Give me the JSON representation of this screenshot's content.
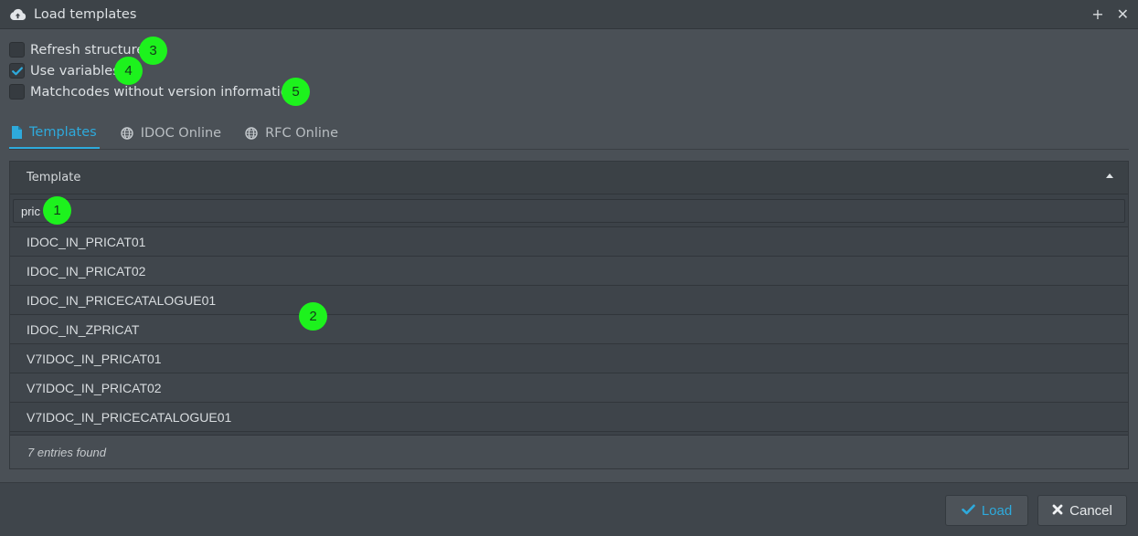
{
  "window": {
    "title": "Load templates",
    "icon": "cloud-upload-icon",
    "plus_symbol": "+",
    "close_symbol": "✕"
  },
  "options": [
    {
      "label": "Refresh structure",
      "checked": false
    },
    {
      "label": "Use variables",
      "checked": true
    },
    {
      "label": "Matchcodes without version information",
      "checked": false
    }
  ],
  "tabs": [
    {
      "label": "Templates",
      "icon": "document-icon",
      "active": true
    },
    {
      "label": "IDOC Online",
      "icon": "globe-icon",
      "active": false
    },
    {
      "label": "RFC Online",
      "icon": "globe-icon",
      "active": false
    }
  ],
  "grid": {
    "column_header": "Template",
    "filter_value": "pric",
    "rows": [
      "IDOC_IN_PRICAT01",
      "IDOC_IN_PRICAT02",
      "IDOC_IN_PRICECATALOGUE01",
      "IDOC_IN_ZPRICAT",
      "V7IDOC_IN_PRICAT01",
      "V7IDOC_IN_PRICAT02",
      "V7IDOC_IN_PRICECATALOGUE01"
    ],
    "footer": "7 entries found"
  },
  "annotations": [
    "1",
    "2",
    "3",
    "4",
    "5"
  ],
  "buttons": {
    "load_label": "Load",
    "cancel_label": "Cancel"
  },
  "colors": {
    "accent": "#2eaadc",
    "annotation_badge": "#1df21d",
    "background": "#4a5056"
  }
}
